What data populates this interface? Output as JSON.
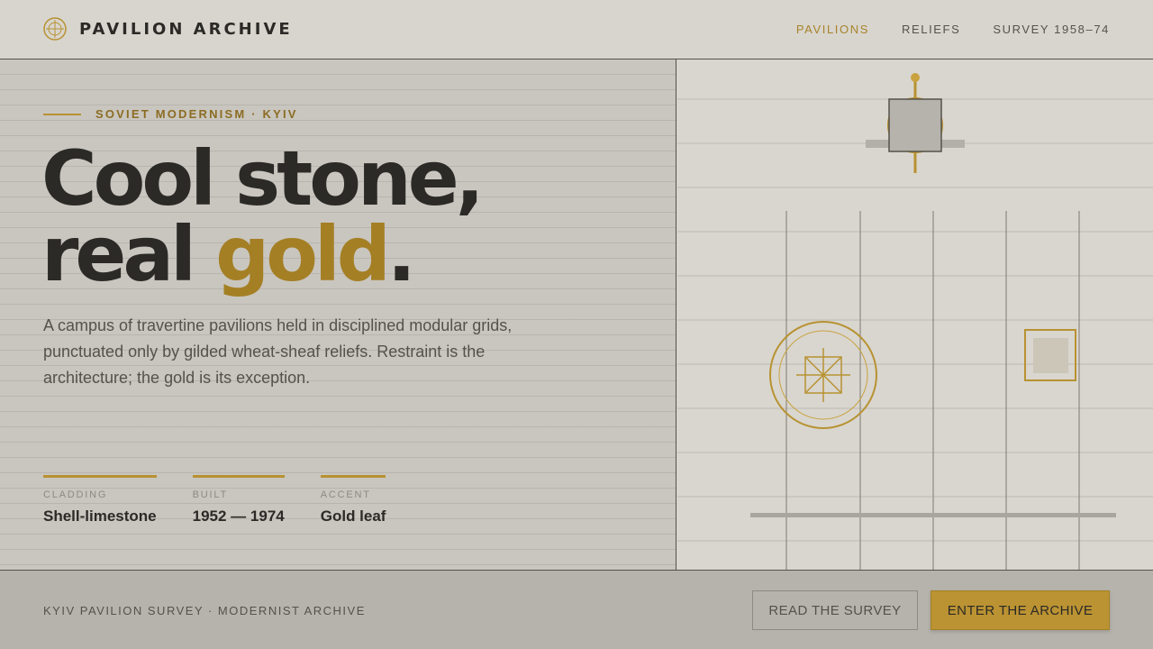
{
  "header": {
    "brand_name": "PAVILION ARCHIVE",
    "brand_icon": "target-crosshair-icon",
    "nav": [
      {
        "label": "PAVILIONS",
        "active": true
      },
      {
        "label": "RELIEFS",
        "active": false
      },
      {
        "label": "SURVEY 1958–74",
        "active": false
      }
    ]
  },
  "hero": {
    "eyebrow": "SOVIET MODERNISM · KYIV",
    "headline_line1": "Cool stone,",
    "headline_line2_prefix": "real ",
    "headline_accent": "gold",
    "headline_line2_suffix": ".",
    "description": "A campus of travertine pavilions held in disciplined modular grids, punctuated only by gilded wheat-sheaf reliefs. Restraint is the architecture; the gold is its exception."
  },
  "specs": [
    {
      "label": "CLADDING",
      "value": "Shell-limestone"
    },
    {
      "label": "BUILT",
      "value": "1952 — 1974"
    },
    {
      "label": "ACCENT",
      "value": "Gold leaf"
    }
  ],
  "footer": {
    "caption": "KYIV PAVILION SURVEY · MODERNIST ARCHIVE",
    "secondary_button": "READ THE SURVEY",
    "primary_button": "ENTER THE ARCHIVE"
  },
  "colors": {
    "accent_gold": "#bb9332",
    "text_dark": "#2b2a27",
    "stone_light": "#d8d5ce",
    "stone_mid": "#c9c6bf"
  }
}
